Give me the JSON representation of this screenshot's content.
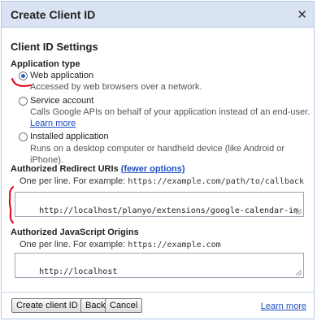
{
  "dialog": {
    "title": "Create Client ID",
    "close_glyph": "✕"
  },
  "settings": {
    "title": "Client ID Settings",
    "application_type": {
      "label": "Application type",
      "options": [
        {
          "label": "Web application",
          "description": "Accessed by web browsers over a network.",
          "checked": true
        },
        {
          "label": "Service account",
          "description": "Calls Google APIs on behalf of your application instead of an end-user.",
          "link": "Learn more",
          "checked": false
        },
        {
          "label": "Installed application",
          "description": "Runs on a desktop computer or handheld device (like Android or iPhone).",
          "checked": false
        }
      ]
    },
    "redirect": {
      "label": "Authorized Redirect URIs",
      "toggle_link": "(fewer options)",
      "example_prefix": "One per line. For example:",
      "example_value": "https://example.com/path/to/callback",
      "value": "http://localhost/planyo/extensions/google-calendar-import/goog.php"
    },
    "origins": {
      "label": "Authorized JavaScript Origins",
      "example_prefix": "One per line. For example:",
      "example_value": "https://example.com",
      "value": "http://localhost"
    }
  },
  "buttons": {
    "create": "Create client ID",
    "back": "Back",
    "cancel": "Cancel"
  },
  "footer": {
    "learn_more": "Learn more"
  },
  "colors": {
    "header_bg": "#d9e3f3",
    "link": "#1f4fc2",
    "annotation": "#e0001b"
  }
}
